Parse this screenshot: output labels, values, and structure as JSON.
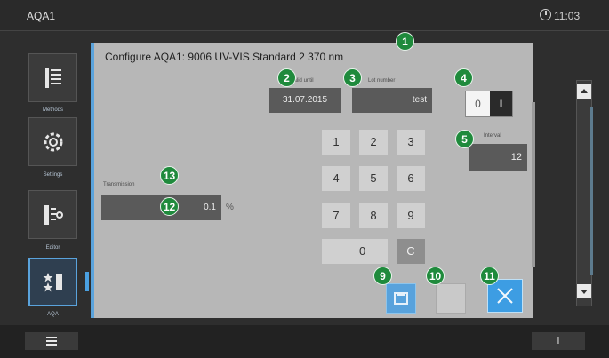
{
  "topbar": {
    "app_title": "AQA1",
    "clock_icon": "clock-icon",
    "time": "11:03"
  },
  "sidebar": {
    "items": [
      {
        "icon": "methods-list-icon",
        "label": "Methods"
      },
      {
        "icon": "settings-gear-icon",
        "label": "Settings"
      },
      {
        "icon": "editor-icon",
        "label": "Editor"
      },
      {
        "icon": "aqa-stars-icon",
        "label": "AQA",
        "active": true
      }
    ]
  },
  "dialog": {
    "title": "Configure AQA1: 9006 UV-VIS Standard 2 370 nm",
    "expiry_date": {
      "label": "Valid until",
      "value": "31.07.2015"
    },
    "lot_number": {
      "label": "Lot number",
      "value": "test"
    },
    "toggle": {
      "off_label": "0",
      "on_label": "I",
      "state": "on"
    },
    "interval": {
      "label": "Interval",
      "value": "12"
    },
    "transmission": {
      "label": "Transmission",
      "value": "0.1",
      "unit": "%"
    },
    "keypad": {
      "keys": [
        "1",
        "2",
        "3",
        "4",
        "5",
        "6",
        "7",
        "8",
        "9",
        "0",
        "C"
      ]
    }
  },
  "actions": {
    "save_icon": "save-icon",
    "close_icon": "close-icon"
  },
  "bottombar": {
    "menu_icon": "menu-icon",
    "info_label": "i"
  },
  "markers": [
    "1",
    "2",
    "3",
    "4",
    "5",
    "9",
    "10",
    "11",
    "12",
    "13"
  ],
  "colors": {
    "accent": "#4aa0e0",
    "marker": "#1f8a3c",
    "dialog_bg": "#b7b7b7",
    "field_bg": "#5a5a5a"
  }
}
